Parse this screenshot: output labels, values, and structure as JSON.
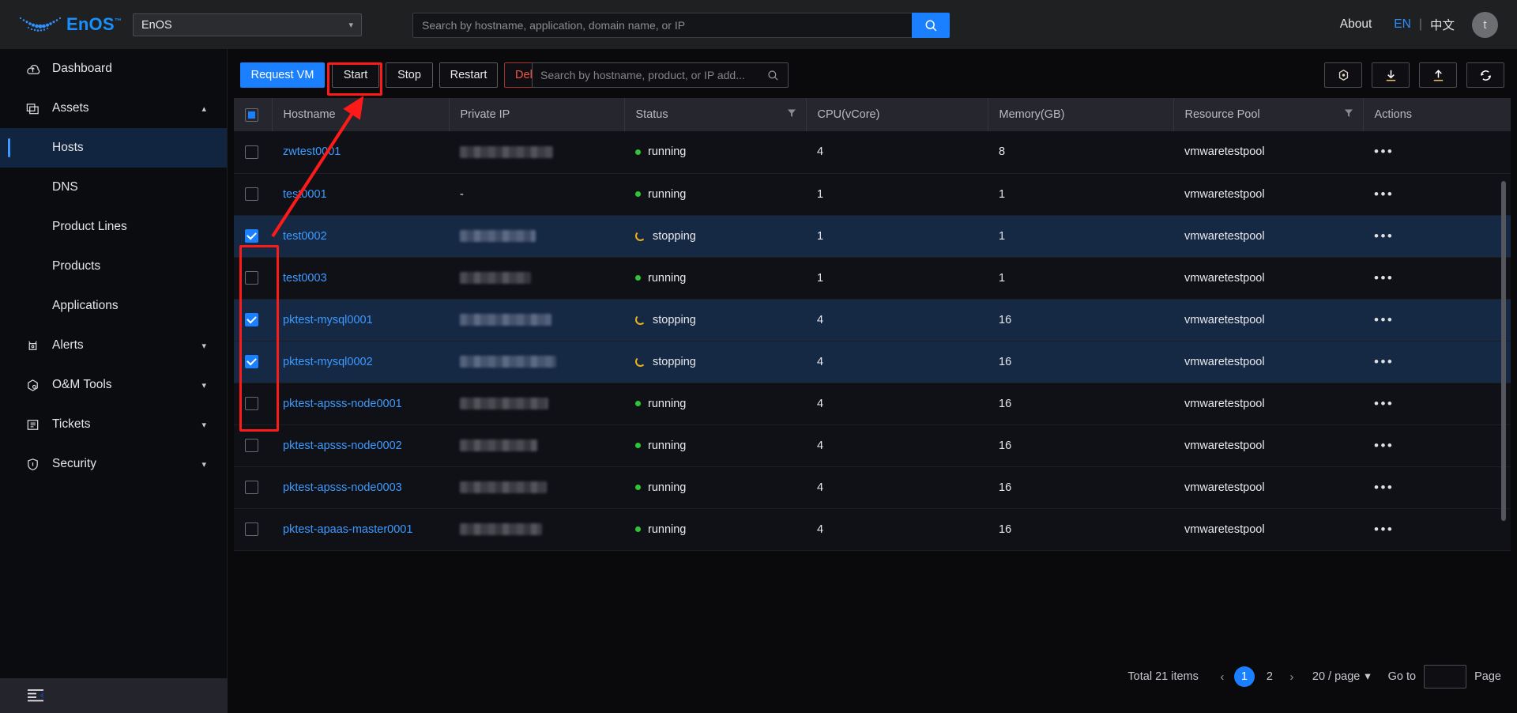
{
  "header": {
    "brand_name": "EnOS",
    "brand_tm": "™",
    "tenant_value": "EnOS",
    "search_placeholder": "Search by hostname, application, domain name, or IP",
    "about_label": "About",
    "lang_en": "EN",
    "lang_sep": "|",
    "lang_cn": "中文",
    "avatar_initial": "t",
    "accent": "#1a80ff"
  },
  "sidebar": {
    "items": [
      {
        "label": "Dashboard",
        "icon": "dashboard-icon",
        "type": "item",
        "arrow": ""
      },
      {
        "label": "Assets",
        "icon": "assets-icon",
        "type": "item",
        "arrow": "up"
      },
      {
        "label": "Hosts",
        "icon": "",
        "type": "sub",
        "active": true
      },
      {
        "label": "DNS",
        "icon": "",
        "type": "sub",
        "active": false
      },
      {
        "label": "Product Lines",
        "icon": "",
        "type": "sub",
        "active": false
      },
      {
        "label": "Products",
        "icon": "",
        "type": "sub",
        "active": false
      },
      {
        "label": "Applications",
        "icon": "",
        "type": "sub",
        "active": false
      },
      {
        "label": "Alerts",
        "icon": "alerts-icon",
        "type": "item",
        "arrow": "down"
      },
      {
        "label": "O&M Tools",
        "icon": "om-tools-icon",
        "type": "item",
        "arrow": "down"
      },
      {
        "label": "Tickets",
        "icon": "tickets-icon",
        "type": "item",
        "arrow": "down"
      },
      {
        "label": "Security",
        "icon": "security-icon",
        "type": "item",
        "arrow": "down"
      }
    ],
    "collapse_icon": "collapse-sidebar-icon"
  },
  "toolbar": {
    "request_vm": "Request VM",
    "start": "Start",
    "stop": "Stop",
    "restart": "Restart",
    "delete": "Delete",
    "search_placeholder": "Search by hostname, product, or IP add...",
    "icons": [
      "settings-icon",
      "download-icon",
      "upload-icon",
      "refresh-icon"
    ]
  },
  "table": {
    "select_all_state": "indeterminate",
    "columns": [
      {
        "key": "checkbox",
        "label": ""
      },
      {
        "key": "hostname",
        "label": "Hostname",
        "filter": false
      },
      {
        "key": "private_ip",
        "label": "Private IP",
        "filter": false
      },
      {
        "key": "status",
        "label": "Status",
        "filter": true
      },
      {
        "key": "cpu",
        "label": "CPU(vCore)",
        "filter": false
      },
      {
        "key": "memory",
        "label": "Memory(GB)",
        "filter": false
      },
      {
        "key": "pool",
        "label": "Resource Pool",
        "filter": true
      },
      {
        "key": "actions",
        "label": "Actions",
        "filter": false
      }
    ],
    "rows": [
      {
        "selected": false,
        "hostname": "zwtest0001",
        "private_ip": "",
        "ip_masked": true,
        "status": "running",
        "cpu": "4",
        "memory": "8",
        "pool": "vmwaretestpool",
        "actions": "•••"
      },
      {
        "selected": false,
        "hostname": "test0001",
        "private_ip": "-",
        "ip_masked": false,
        "status": "running",
        "cpu": "1",
        "memory": "1",
        "pool": "vmwaretestpool",
        "actions": "•••"
      },
      {
        "selected": true,
        "hostname": "test0002",
        "private_ip": "",
        "ip_masked": true,
        "status": "stopping",
        "cpu": "1",
        "memory": "1",
        "pool": "vmwaretestpool",
        "actions": "•••"
      },
      {
        "selected": false,
        "hostname": "test0003",
        "private_ip": "",
        "ip_masked": true,
        "status": "running",
        "cpu": "1",
        "memory": "1",
        "pool": "vmwaretestpool",
        "actions": "•••"
      },
      {
        "selected": true,
        "hostname": "pktest-mysql0001",
        "private_ip": "",
        "ip_masked": true,
        "status": "stopping",
        "cpu": "4",
        "memory": "16",
        "pool": "vmwaretestpool",
        "actions": "•••"
      },
      {
        "selected": true,
        "hostname": "pktest-mysql0002",
        "private_ip": "",
        "ip_masked": true,
        "status": "stopping",
        "cpu": "4",
        "memory": "16",
        "pool": "vmwaretestpool",
        "actions": "•••"
      },
      {
        "selected": false,
        "hostname": "pktest-apsss-node0001",
        "private_ip": "",
        "ip_masked": true,
        "status": "running",
        "cpu": "4",
        "memory": "16",
        "pool": "vmwaretestpool",
        "actions": "•••"
      },
      {
        "selected": false,
        "hostname": "pktest-apsss-node0002",
        "private_ip": "",
        "ip_masked": true,
        "status": "running",
        "cpu": "4",
        "memory": "16",
        "pool": "vmwaretestpool",
        "actions": "•••"
      },
      {
        "selected": false,
        "hostname": "pktest-apsss-node0003",
        "private_ip": "",
        "ip_masked": true,
        "status": "running",
        "cpu": "4",
        "memory": "16",
        "pool": "vmwaretestpool",
        "actions": "•••"
      },
      {
        "selected": false,
        "hostname": "pktest-apaas-master0001",
        "private_ip": "",
        "ip_masked": true,
        "status": "running",
        "cpu": "4",
        "memory": "16",
        "pool": "vmwaretestpool",
        "actions": "•••"
      }
    ]
  },
  "pagination": {
    "total_label": "Total 21 items",
    "prev": "‹",
    "next": "›",
    "pages": [
      "1",
      "2"
    ],
    "current_page": "1",
    "page_size_label": "20 / page",
    "goto_label": "Go to",
    "goto_value": "",
    "page_suffix": "Page"
  },
  "annotations": {
    "color": "#ff1a1a",
    "highlight_start_button": true,
    "highlight_checkbox_column": true,
    "arrow_from_to": "checkbox-column to start-button"
  }
}
